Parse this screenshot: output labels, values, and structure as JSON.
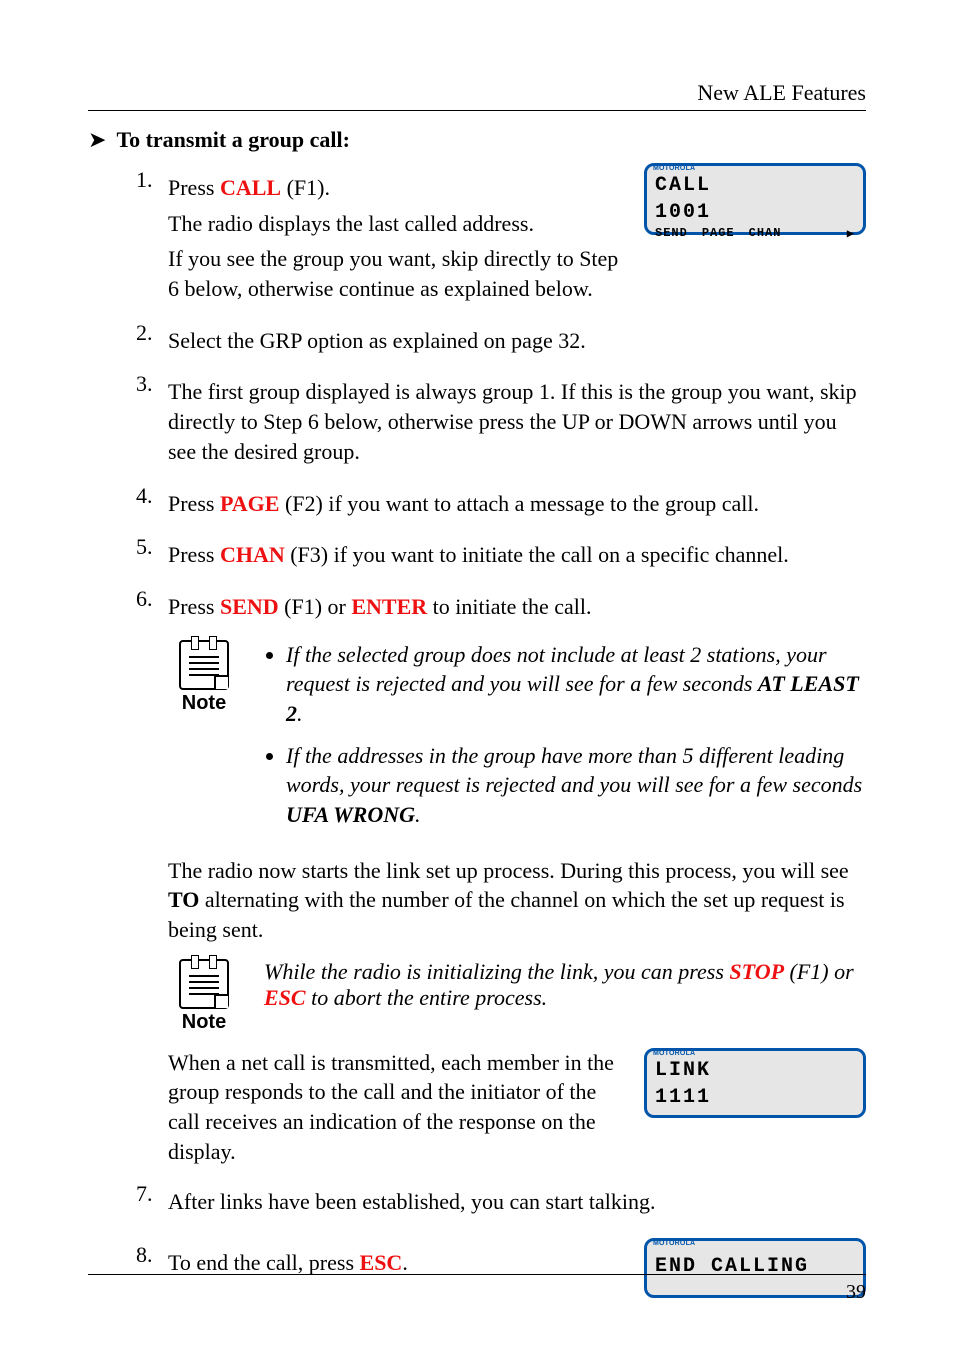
{
  "header": {
    "title": "New ALE Features"
  },
  "section": {
    "arrow": "➤",
    "heading": "To transmit a group call:"
  },
  "steps": {
    "s1": {
      "n": "1.",
      "line1_a": "Press ",
      "line1_key": "CALL",
      "line1_b": " (F1).",
      "line2": "The radio displays the last called address.",
      "line3": "If you see the group you want, skip directly to Step 6 below, otherwise continue as explained below."
    },
    "s2": {
      "n": "2.",
      "text": "Select the GRP option as explained on page 32."
    },
    "s3": {
      "n": "3.",
      "text": "The first group displayed is always group 1. If this is the group you want, skip directly to Step 6 below, otherwise press the UP or DOWN arrows until you see the desired group."
    },
    "s4": {
      "n": "4.",
      "a": "Press ",
      "key": "PAGE",
      "b": " (F2) if you want to attach a message to the group call."
    },
    "s5": {
      "n": "5.",
      "a": "Press ",
      "key": "CHAN",
      "b": " (F3) if you want to initiate the call on a specific channel."
    },
    "s6": {
      "n": "6.",
      "a": "Press ",
      "key1": "SEND",
      "mid": " (F1) or ",
      "key2": "ENTER",
      "b": " to initiate the call."
    },
    "s7": {
      "n": "7.",
      "text": "After links have been established, you can start talking."
    },
    "s8": {
      "n": "8.",
      "a": "To end the call, press ",
      "key": "ESC",
      "b": "."
    }
  },
  "note1": {
    "label": "Note",
    "b1_a": "If the selected group does not include at least 2 stations, your request is rejected and you will see for a few seconds ",
    "b1_strong": "AT LEAST 2",
    "b1_b": ".",
    "b2_a": "If the addresses in the group have more than 5 different leading words, your request is rejected and you will see for a few seconds ",
    "b2_strong": "UFA WRONG",
    "b2_b": "."
  },
  "mid_para": {
    "a": "The radio now starts the link set up process. During this process, you will see ",
    "strong": "TO",
    "b": " alternating with the number of the channel on which the set up request is being sent."
  },
  "note2": {
    "label": "Note",
    "a": "While the radio is initializing the link, you can press ",
    "key1": "STOP",
    "mid": " (F1) or ",
    "key2": "ESC",
    "b": " to abort the entire process."
  },
  "link_para": "When a net call is transmitted, each member in the group responds to the call and the initiator of the call receives an indication of the response on the display.",
  "lcd1": {
    "brand": "MOTOROLA",
    "line1": "CALL",
    "line2": "1001",
    "soft1": "SEND",
    "soft2": "PAGE",
    "soft3": "CHAN",
    "more": "▶"
  },
  "lcd2": {
    "brand": "MOTOROLA",
    "line1": "LINK",
    "line2": "1111"
  },
  "lcd3": {
    "brand": "MOTOROLA",
    "line1": "END CALLING"
  },
  "footer": {
    "page": "39"
  }
}
